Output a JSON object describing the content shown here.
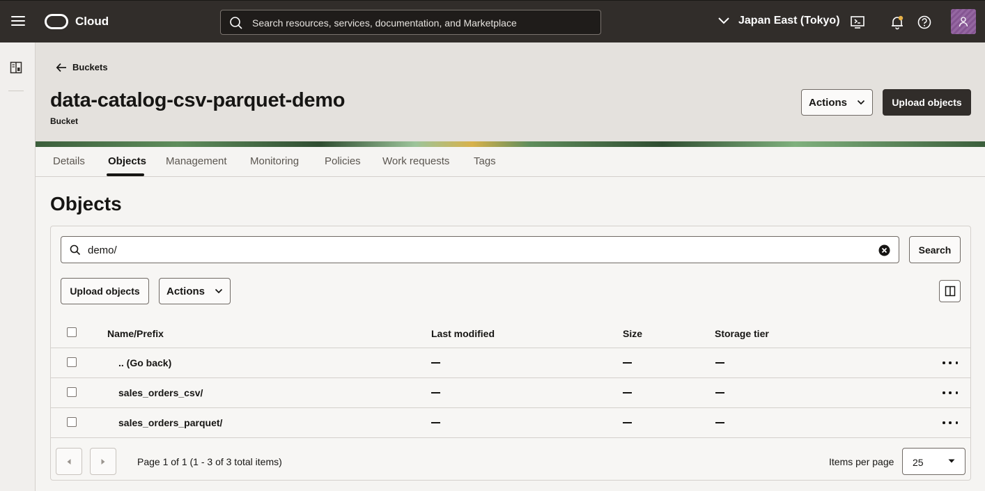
{
  "topbar": {
    "brand": "Cloud",
    "search_placeholder": "Search resources, services, documentation, and Marketplace",
    "region": "Japan East (Tokyo)",
    "icons": [
      "menu-icon",
      "cloud-shell-icon",
      "notifications-icon",
      "help-icon",
      "user-avatar-icon"
    ]
  },
  "breadcrumb": {
    "back_label": "Buckets"
  },
  "header": {
    "title": "data-catalog-csv-parquet-demo",
    "subtitle": "Bucket",
    "actions_label": "Actions",
    "upload_label": "Upload objects"
  },
  "tabs": [
    {
      "label": "Details"
    },
    {
      "label": "Objects",
      "active": true
    },
    {
      "label": "Management"
    },
    {
      "label": "Monitoring"
    },
    {
      "label": "Policies"
    },
    {
      "label": "Work requests"
    },
    {
      "label": "Tags"
    }
  ],
  "objects": {
    "title": "Objects",
    "filter_value": "demo/",
    "search_label": "Search",
    "upload_label": "Upload objects",
    "actions_label": "Actions",
    "columns": [
      "Name/Prefix",
      "Last modified",
      "Size",
      "Storage tier"
    ],
    "rows": [
      {
        "name": ".. (Go back)",
        "last_modified": "—",
        "size": "—",
        "storage_tier": "—"
      },
      {
        "name": "sales_orders_csv/",
        "last_modified": "—",
        "size": "—",
        "storage_tier": "—"
      },
      {
        "name": "sales_orders_parquet/",
        "last_modified": "—",
        "size": "—",
        "storage_tier": "—"
      }
    ],
    "pagination": {
      "info": "Page 1 of 1 (1 - 3 of 3 total items)",
      "items_per_page_label": "Items per page",
      "items_per_page": "25"
    }
  },
  "colors": {
    "topbar_bg": "#312d2a",
    "header_bg": "#e4e1dd",
    "primary_button": "#312d2a"
  }
}
